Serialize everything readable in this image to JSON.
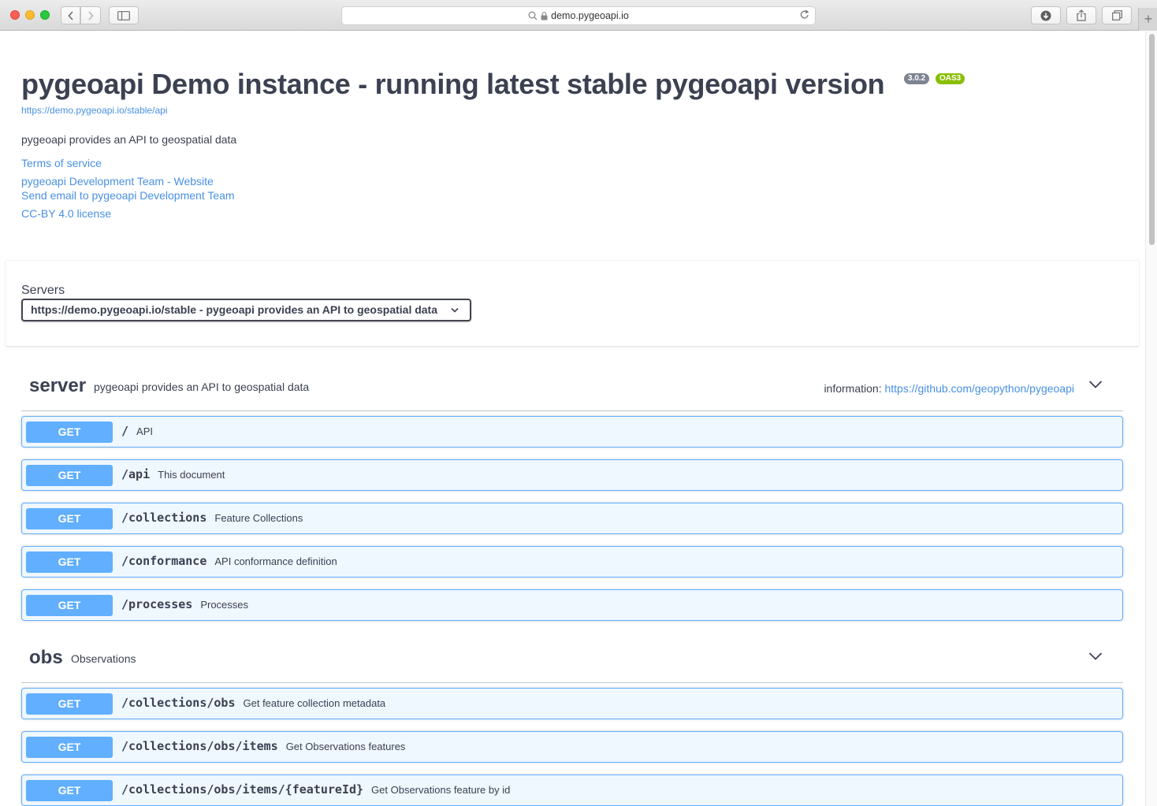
{
  "browser": {
    "url": "demo.pygeoapi.io",
    "new_tab": "+"
  },
  "info": {
    "title": "pygeoapi Demo instance - running latest stable pygeoapi version",
    "version_badge": "3.0.2",
    "oas_badge": "OAS3",
    "base_url": "https://demo.pygeoapi.io/stable/api",
    "description": "pygeoapi provides an API to geospatial data",
    "links": {
      "terms": "Terms of service",
      "website": "pygeoapi Development Team - Website",
      "email": "Send email to pygeoapi Development Team",
      "license": "CC-BY 4.0 license"
    }
  },
  "servers": {
    "label": "Servers",
    "selected": "https://demo.pygeoapi.io/stable - pygeoapi provides an API to geospatial data"
  },
  "tags": [
    {
      "name": "server",
      "description": "pygeoapi provides an API to geospatial data",
      "info_label": "information:",
      "info_link": "https://github.com/geopython/pygeoapi",
      "operations": [
        {
          "method": "GET",
          "path": "/",
          "summary": "API"
        },
        {
          "method": "GET",
          "path": "/api",
          "summary": "This document"
        },
        {
          "method": "GET",
          "path": "/collections",
          "summary": "Feature Collections"
        },
        {
          "method": "GET",
          "path": "/conformance",
          "summary": "API conformance definition"
        },
        {
          "method": "GET",
          "path": "/processes",
          "summary": "Processes"
        }
      ]
    },
    {
      "name": "obs",
      "description": "Observations",
      "operations": [
        {
          "method": "GET",
          "path": "/collections/obs",
          "summary": "Get feature collection metadata"
        },
        {
          "method": "GET",
          "path": "/collections/obs/items",
          "summary": "Get Observations features"
        },
        {
          "method": "GET",
          "path": "/collections/obs/items/{featureId}",
          "summary": "Get Observations feature by id"
        }
      ]
    }
  ],
  "colors": {
    "get_method": "#61affe",
    "link": "#4990e2",
    "text": "#3b4151",
    "oas_badge": "#89bf04",
    "version_badge": "#7d8492"
  }
}
